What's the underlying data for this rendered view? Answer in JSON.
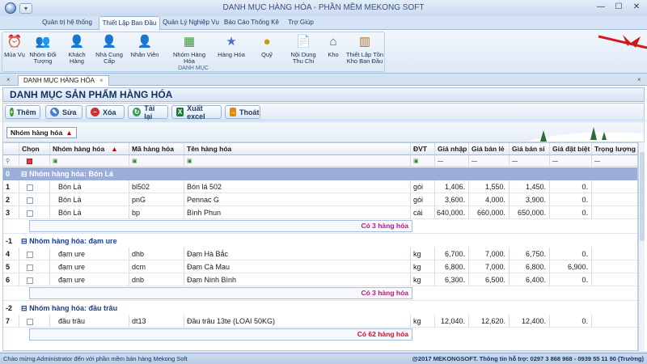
{
  "window": {
    "title": "DANH MỤC HÀNG HÓA - PHẦN MỀM MEKONG SOFT",
    "minimize": "—",
    "maximize": "☐",
    "close": "✕"
  },
  "tabs": [
    "Quản trị hệ thống",
    "Thiết Lập Ban Đầu",
    "Quản Lý Nghiệp Vụ",
    "Báo Cáo Thống Kê",
    "Trợ Giúp"
  ],
  "ribbon": {
    "group_label": "DANH MỤC",
    "buttons": [
      {
        "label": "Mùa Vụ",
        "icon": "clock-icon"
      },
      {
        "label": "Nhóm Đối Tượng",
        "icon": "people-group-icon"
      },
      {
        "label": "Khách Hàng",
        "icon": "customer-icon"
      },
      {
        "label": "Nhà Cung Cấp",
        "icon": "supplier-icon"
      },
      {
        "label": "Nhân Viên",
        "icon": "employee-icon"
      },
      {
        "label": "Nhóm Hàng Hóa",
        "icon": "product-group-icon"
      },
      {
        "label": "Hàng Hóa",
        "icon": "star-icon"
      },
      {
        "label": "Quỹ",
        "icon": "coins-icon"
      },
      {
        "label": "Nội Dung Thu Chi",
        "icon": "document-icon"
      },
      {
        "label": "Kho",
        "icon": "warehouse-icon"
      },
      {
        "label": "Thiết Lập Tồn Kho Ban Đầu",
        "icon": "inventory-icon"
      }
    ]
  },
  "doc_tab": {
    "label": "DANH MỤC HÀNG HÓA",
    "close": "×"
  },
  "panel": {
    "heading": "DANH MỤC SẢN PHẨM HÀNG HÓA"
  },
  "toolbar": {
    "add": "Thêm",
    "edit": "Sửa",
    "delete": "Xóa",
    "reload": "Tải lại",
    "export": "Xuất excel",
    "exit": "Thoát"
  },
  "group_by_chip": "Nhóm hàng hóa",
  "grid": {
    "columns": [
      "Chọn",
      "Nhóm hàng hóa",
      "Mã hàng hóa",
      "Tên hàng hóa",
      "ĐVT",
      "Giá nhập",
      "Giá bán lẻ",
      "Giá bán sỉ",
      "Giá đặt biệt",
      "Trọng lượng"
    ],
    "filter_dash": "—",
    "groups": [
      {
        "rownum": "0",
        "expander": "⊟",
        "label": "Nhóm hàng hóa: Bón Lá",
        "selected": true,
        "rows": [
          {
            "n": "1",
            "group": "Bón Lá",
            "code": "bl502",
            "name": "Bón lá 502",
            "unit": "gói",
            "buy": "1,406.",
            "retail": "1,550.",
            "wholesale": "1,450.",
            "special": "0.",
            "weight": ""
          },
          {
            "n": "2",
            "group": "Bón Lá",
            "code": "pnG",
            "name": "Pennac G",
            "unit": "gói",
            "buy": "3,600.",
            "retail": "4,000.",
            "wholesale": "3,900.",
            "special": "0.",
            "weight": ""
          },
          {
            "n": "3",
            "group": "Bón Lá",
            "code": "bp",
            "name": "Bình Phun",
            "unit": "cái",
            "buy": "640,000.",
            "retail": "660,000.",
            "wholesale": "650,000.",
            "special": "0.",
            "weight": ""
          }
        ],
        "summary": "Có 3 hàng hóa",
        "summary_color": "#c8108a"
      },
      {
        "rownum": "-1",
        "expander": "⊟",
        "label": "Nhóm hàng hóa: đạm ure",
        "selected": false,
        "rows": [
          {
            "n": "4",
            "group": "đạm ure",
            "code": "dhb",
            "name": "Đạm Hà Bắc",
            "unit": "kg",
            "buy": "6,700.",
            "retail": "7,000.",
            "wholesale": "6,750.",
            "special": "0.",
            "weight": ""
          },
          {
            "n": "5",
            "group": "đạm ure",
            "code": "dcm",
            "name": "Đạm Cà Mau",
            "unit": "kg",
            "buy": "6,800.",
            "retail": "7,000.",
            "wholesale": "6,800.",
            "special": "6,900.",
            "weight": ""
          },
          {
            "n": "6",
            "group": "đạm ure",
            "code": "dnb",
            "name": "Đạm Ninh Bình",
            "unit": "kg",
            "buy": "6,300.",
            "retail": "6,500.",
            "wholesale": "6,400.",
            "special": "0.",
            "weight": ""
          }
        ],
        "summary": "Có 3 hàng hóa",
        "summary_color": "#c8108a"
      },
      {
        "rownum": "-2",
        "expander": "⊟",
        "label": "Nhóm hàng hóa: đầu trâu",
        "selected": false,
        "rows": [
          {
            "n": "7",
            "group": "đầu trâu",
            "code": "dt13",
            "name": "Đầu trâu 13te (LOAI 50KG)",
            "unit": "kg",
            "buy": "12,040.",
            "retail": "12,620.",
            "wholesale": "12,400.",
            "special": "0.",
            "weight": ""
          }
        ],
        "summary": "Có 62 hàng hóa",
        "summary_color": "#d0102a"
      }
    ]
  },
  "status": {
    "left": "Chào mừng Administrator đến với phần mềm bán hàng Mekong Soft",
    "right": "@2017 MEKONGSOFT. Thông tin hỗ trợ: 0297 3 868 968 - 0939 55 11 90 (Trường)"
  }
}
